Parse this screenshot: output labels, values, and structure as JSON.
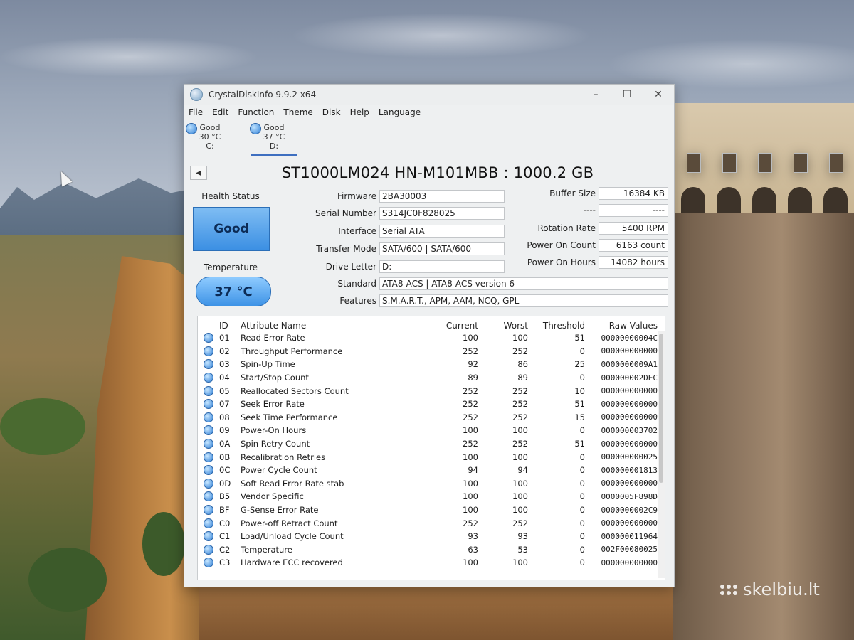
{
  "window": {
    "title": "CrystalDiskInfo 9.9.2 x64",
    "minimize": "–",
    "maximize": "☐",
    "close": "✕"
  },
  "menu": [
    "File",
    "Edit",
    "Function",
    "Theme",
    "Disk",
    "Help",
    "Language"
  ],
  "disk_tabs": [
    {
      "status": "Good",
      "temp": "30 °C",
      "drive": "C:"
    },
    {
      "status": "Good",
      "temp": "37 °C",
      "drive": "D:"
    }
  ],
  "drive": {
    "prev_button": "◀",
    "title": "ST1000LM024 HN-M101MBB : 1000.2 GB"
  },
  "health": {
    "label": "Health Status",
    "value": "Good"
  },
  "temperature": {
    "label": "Temperature",
    "value": "37 °C"
  },
  "fields": {
    "firmware_label": "Firmware",
    "firmware": "2BA30003",
    "serial_label": "Serial Number",
    "serial": "S314JC0F828025",
    "interface_label": "Interface",
    "interface": "Serial ATA",
    "transfer_label": "Transfer Mode",
    "transfer": "SATA/600 | SATA/600",
    "letter_label": "Drive Letter",
    "letter": "D:",
    "standard_label": "Standard",
    "standard": "ATA8-ACS | ATA8-ACS version 6",
    "features_label": "Features",
    "features": "S.M.A.R.T., APM, AAM, NCQ, GPL",
    "buffer_label": "Buffer Size",
    "buffer": "16384 KB",
    "blank_label": "----",
    "blank": "----",
    "rotation_label": "Rotation Rate",
    "rotation": "5400 RPM",
    "power_count_label": "Power On Count",
    "power_count": "6163 count",
    "power_hours_label": "Power On Hours",
    "power_hours": "14082 hours"
  },
  "smart": {
    "headers": {
      "id": "ID",
      "name": "Attribute Name",
      "current": "Current",
      "worst": "Worst",
      "threshold": "Threshold",
      "raw": "Raw Values"
    },
    "rows": [
      {
        "id": "01",
        "name": "Read Error Rate",
        "current": "100",
        "worst": "100",
        "threshold": "51",
        "raw": "00000000004C"
      },
      {
        "id": "02",
        "name": "Throughput Performance",
        "current": "252",
        "worst": "252",
        "threshold": "0",
        "raw": "000000000000"
      },
      {
        "id": "03",
        "name": "Spin-Up Time",
        "current": "92",
        "worst": "86",
        "threshold": "25",
        "raw": "0000000009A1"
      },
      {
        "id": "04",
        "name": "Start/Stop Count",
        "current": "89",
        "worst": "89",
        "threshold": "0",
        "raw": "000000002DEC"
      },
      {
        "id": "05",
        "name": "Reallocated Sectors Count",
        "current": "252",
        "worst": "252",
        "threshold": "10",
        "raw": "000000000000"
      },
      {
        "id": "07",
        "name": "Seek Error Rate",
        "current": "252",
        "worst": "252",
        "threshold": "51",
        "raw": "000000000000"
      },
      {
        "id": "08",
        "name": "Seek Time Performance",
        "current": "252",
        "worst": "252",
        "threshold": "15",
        "raw": "000000000000"
      },
      {
        "id": "09",
        "name": "Power-On Hours",
        "current": "100",
        "worst": "100",
        "threshold": "0",
        "raw": "000000003702"
      },
      {
        "id": "0A",
        "name": "Spin Retry Count",
        "current": "252",
        "worst": "252",
        "threshold": "51",
        "raw": "000000000000"
      },
      {
        "id": "0B",
        "name": "Recalibration Retries",
        "current": "100",
        "worst": "100",
        "threshold": "0",
        "raw": "000000000025"
      },
      {
        "id": "0C",
        "name": "Power Cycle Count",
        "current": "94",
        "worst": "94",
        "threshold": "0",
        "raw": "000000001813"
      },
      {
        "id": "0D",
        "name": "Soft Read Error Rate stab",
        "current": "100",
        "worst": "100",
        "threshold": "0",
        "raw": "000000000000"
      },
      {
        "id": "B5",
        "name": "Vendor Specific",
        "current": "100",
        "worst": "100",
        "threshold": "0",
        "raw": "0000005F898D"
      },
      {
        "id": "BF",
        "name": "G-Sense Error Rate",
        "current": "100",
        "worst": "100",
        "threshold": "0",
        "raw": "0000000002C9"
      },
      {
        "id": "C0",
        "name": "Power-off Retract Count",
        "current": "252",
        "worst": "252",
        "threshold": "0",
        "raw": "000000000000"
      },
      {
        "id": "C1",
        "name": "Load/Unload Cycle Count",
        "current": "93",
        "worst": "93",
        "threshold": "0",
        "raw": "000000011964"
      },
      {
        "id": "C2",
        "name": "Temperature",
        "current": "63",
        "worst": "53",
        "threshold": "0",
        "raw": "002F00080025"
      },
      {
        "id": "C3",
        "name": "Hardware ECC recovered",
        "current": "100",
        "worst": "100",
        "threshold": "0",
        "raw": "000000000000"
      }
    ]
  },
  "watermark": "skelbiu.lt",
  "colors": {
    "good_blue": "#3b8fe3",
    "window_bg": "#eef0f1"
  }
}
